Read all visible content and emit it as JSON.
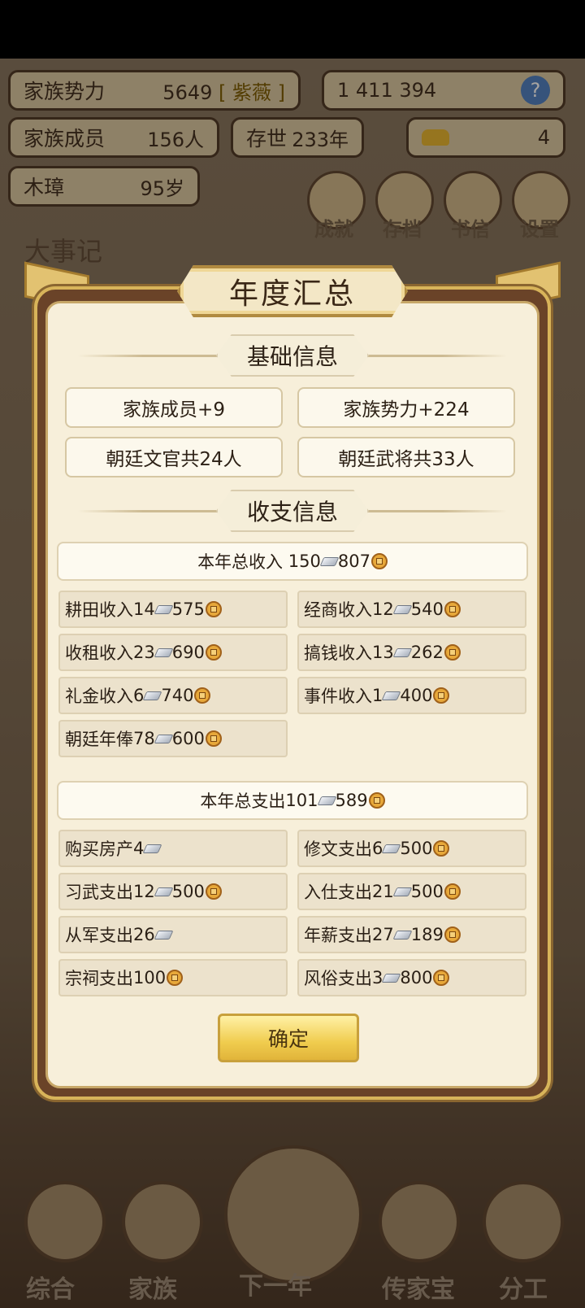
{
  "hud": {
    "family_power_label": "家族势力",
    "family_power_value": "5649",
    "family_power_badge": "[ 紫薇 ]",
    "currency_text": "1 411 394",
    "family_members_label": "家族成员",
    "family_members_value": "156人",
    "existence_label": "存世",
    "existence_value": "233年",
    "ingot_count": "4",
    "patriarch_name": "木璋",
    "patriarch_age": "95岁",
    "menu_buttons": [
      "成就",
      "存档",
      "书信",
      "设置"
    ],
    "events_title": "大事记"
  },
  "modal": {
    "title": "年度汇总",
    "basic_section_title": "基础信息",
    "basic_info": [
      "家族成员+9",
      "家族势力+224",
      "朝廷文官共24人",
      "朝廷武将共33人"
    ],
    "finance_section_title": "收支信息",
    "income_total": {
      "label": "本年总收入",
      "silver": "150",
      "copper": "807"
    },
    "income_items": [
      {
        "label": "耕田收入",
        "silver": "14",
        "copper": "575"
      },
      {
        "label": "经商收入",
        "silver": "12",
        "copper": "540"
      },
      {
        "label": "收租收入",
        "silver": "23",
        "copper": "690"
      },
      {
        "label": "搞钱收入",
        "silver": "13",
        "copper": "262"
      },
      {
        "label": "礼金收入",
        "silver": "6",
        "copper": "740"
      },
      {
        "label": "事件收入",
        "silver": "1",
        "copper": "400"
      },
      {
        "label": "朝廷年俸",
        "silver": "78",
        "copper": "600"
      }
    ],
    "expense_total": {
      "label": "本年总支出",
      "silver": "101",
      "copper": "589"
    },
    "expense_items": [
      {
        "label": "购买房产",
        "silver": "4",
        "copper": ""
      },
      {
        "label": "修文支出",
        "silver": "6",
        "copper": "500"
      },
      {
        "label": "习武支出",
        "silver": "12",
        "copper": "500"
      },
      {
        "label": "入仕支出",
        "silver": "21",
        "copper": "500"
      },
      {
        "label": "从军支出",
        "silver": "26",
        "copper": ""
      },
      {
        "label": "年薪支出",
        "silver": "27",
        "copper": "189"
      },
      {
        "label": "宗祠支出",
        "silver": "",
        "copper": "100"
      },
      {
        "label": "风俗支出",
        "silver": "3",
        "copper": "800"
      }
    ],
    "confirm_label": "确定"
  },
  "nav": {
    "items": [
      "综合",
      "家族",
      "下一年",
      "传家宝",
      "分工"
    ]
  },
  "icons": {
    "silver": "silver-ingot-icon",
    "copper": "copper-coin-icon",
    "help": "question-icon",
    "add": "plus-icon"
  },
  "colors": {
    "accent_gold": "#e2c271",
    "panel": "#f7efda",
    "frame": "#6a4328"
  }
}
